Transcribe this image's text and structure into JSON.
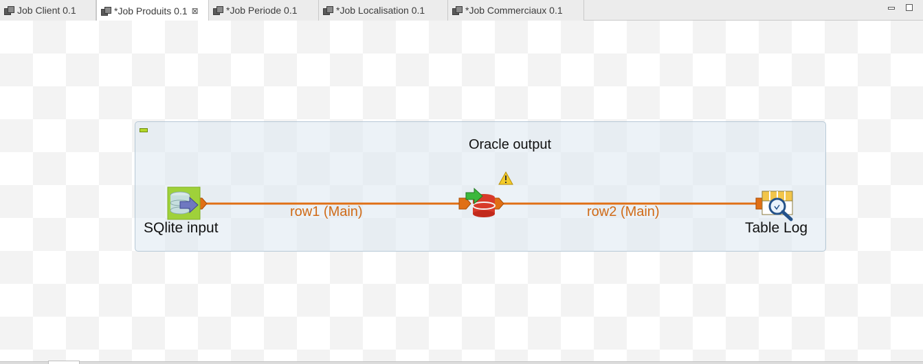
{
  "tabs": [
    {
      "label": "Job Client 0.1",
      "active": false
    },
    {
      "label": "*Job Produits 0.1",
      "active": true,
      "close": "⊠"
    },
    {
      "label": "*Job Periode 0.1",
      "active": false
    },
    {
      "label": "*Job Localisation 0.1",
      "active": false
    },
    {
      "label": "*Job Commerciaux 0.1",
      "active": false
    }
  ],
  "subjob": {
    "title": "Oracle output"
  },
  "components": {
    "sqlite_input": {
      "label": "SQlite input",
      "icon": "sqlite-input-icon"
    },
    "oracle_output": {
      "label": "",
      "icon": "oracle-output-icon",
      "warning": "warning-icon"
    },
    "table_log": {
      "label": "Table Log",
      "icon": "log-row-icon"
    }
  },
  "links": {
    "row1": {
      "label": "row1 (Main)"
    },
    "row2": {
      "label": "row2 (Main)"
    }
  },
  "colors": {
    "link": "#e06f15",
    "link_label": "#d06a16",
    "subjob_toggle": "#b4d828"
  }
}
